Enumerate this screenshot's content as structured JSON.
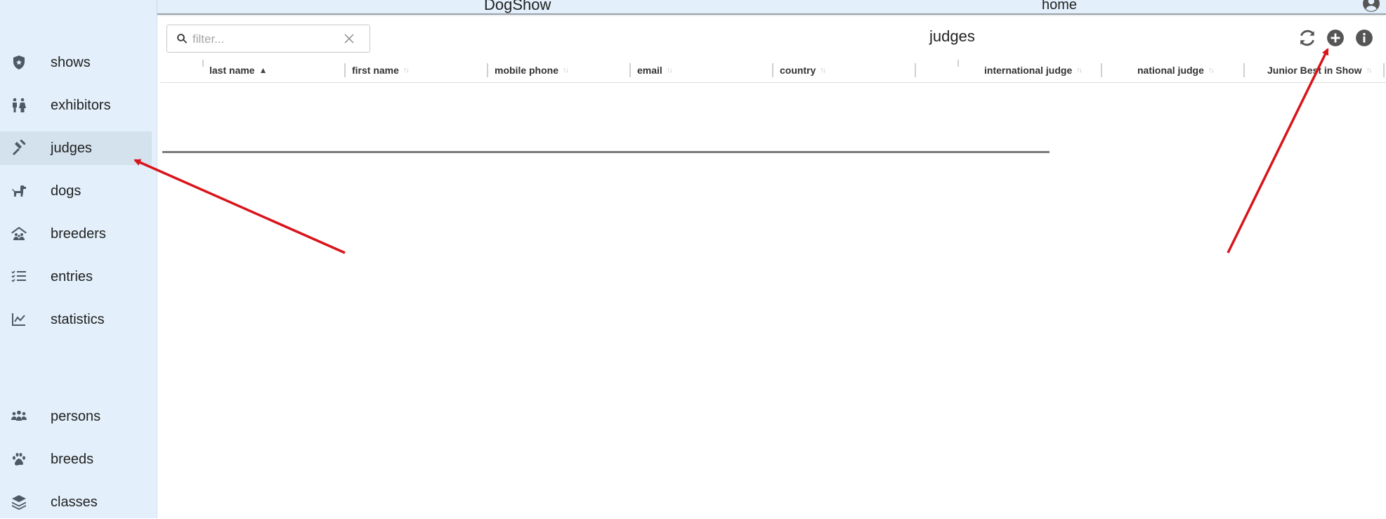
{
  "app": {
    "title": "DogShow",
    "home_label": "home"
  },
  "sidebar": {
    "items": [
      {
        "label": "shows",
        "icon": "shield-icon"
      },
      {
        "label": "exhibitors",
        "icon": "people-icon"
      },
      {
        "label": "judges",
        "icon": "gavel-icon",
        "active": true
      },
      {
        "label": "dogs",
        "icon": "dog-icon"
      },
      {
        "label": "breeders",
        "icon": "house-people-icon"
      },
      {
        "label": "entries",
        "icon": "checklist-icon"
      },
      {
        "label": "statistics",
        "icon": "chart-line-icon"
      },
      {
        "label": "persons",
        "icon": "group-icon"
      },
      {
        "label": "breeds",
        "icon": "paw-icon"
      },
      {
        "label": "classes",
        "icon": "layers-icon"
      }
    ]
  },
  "page": {
    "title": "judges",
    "filter_placeholder": "filter...",
    "filter_value": ""
  },
  "table": {
    "columns": [
      {
        "label": "last name",
        "sort": "asc"
      },
      {
        "label": "first name",
        "sort": "none"
      },
      {
        "label": "mobile phone",
        "sort": "none"
      },
      {
        "label": "email",
        "sort": "none"
      },
      {
        "label": "country",
        "sort": "none"
      },
      {
        "label": "international judge",
        "sort": "none"
      },
      {
        "label": "national judge",
        "sort": "none"
      },
      {
        "label": "Junior Best in Show",
        "sort": "none"
      }
    ],
    "rows": []
  },
  "toolbar": {
    "refresh_icon": "refresh-icon",
    "add_icon": "plus-circle-icon",
    "info_icon": "info-circle-icon"
  },
  "colors": {
    "sidebar_bg": "#e3f0fb",
    "active_item_bg": "#d4e2ee",
    "annotation_arrow": "#d9141b"
  }
}
